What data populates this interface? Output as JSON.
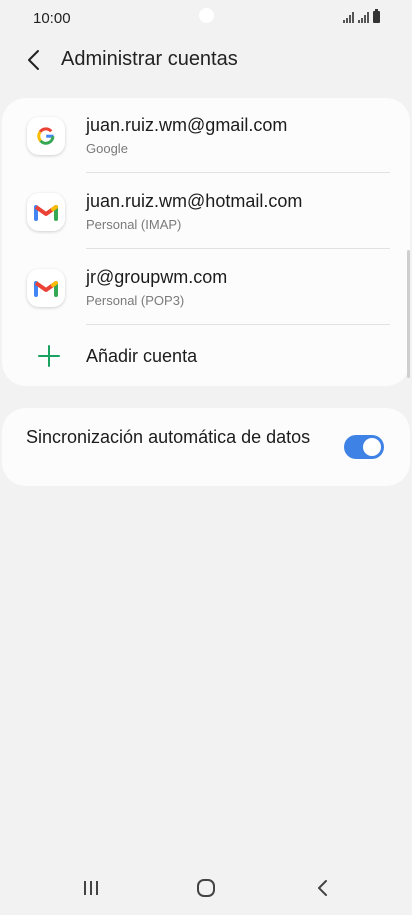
{
  "status_bar": {
    "time": "10:00"
  },
  "header": {
    "title": "Administrar cuentas"
  },
  "accounts": [
    {
      "email": "juan.ruiz.wm@gmail.com",
      "type": "Google",
      "icon": "google-icon"
    },
    {
      "email": "juan.ruiz.wm@hotmail.com",
      "type": "Personal (IMAP)",
      "icon": "gmail-icon"
    },
    {
      "email": "jr@groupwm.com",
      "type": "Personal (POP3)",
      "icon": "gmail-icon"
    }
  ],
  "add_account": {
    "label": "Añadir cuenta"
  },
  "sync": {
    "label": "Sincronización automática de datos",
    "enabled": true
  },
  "colors": {
    "accent": "#3d82e4",
    "add_icon": "#1aa260",
    "background": "#f2f2f2"
  }
}
